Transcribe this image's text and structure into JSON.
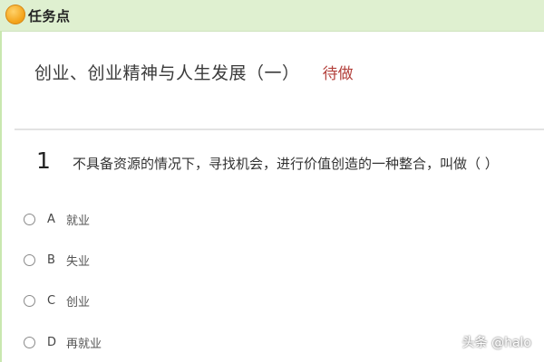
{
  "header": {
    "title": "任务点",
    "icon": "task-point-icon",
    "accent_color": "#dff0d0"
  },
  "task": {
    "title": "创业、创业精神与人生发展（一）",
    "status": "待做",
    "status_color": "#b3413c"
  },
  "question": {
    "number": "1",
    "text": "不具备资源的情况下，寻找机会，进行价值创造的一种整合，叫做（ ）",
    "options": [
      {
        "letter": "A",
        "text": "就业"
      },
      {
        "letter": "B",
        "text": "失业"
      },
      {
        "letter": "C",
        "text": "创业"
      },
      {
        "letter": "D",
        "text": "再就业"
      }
    ]
  },
  "watermark": "头条 @halo"
}
